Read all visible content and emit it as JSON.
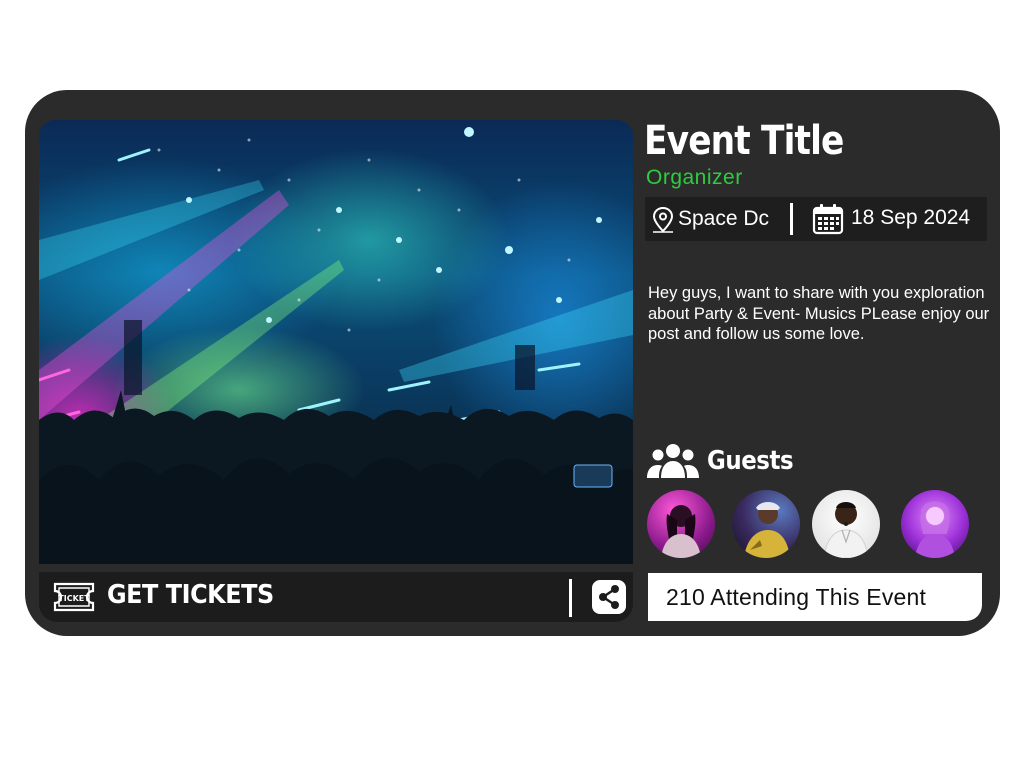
{
  "event": {
    "title": "Event Title",
    "organizer": "Organizer",
    "location": "Space Dc",
    "date": "18 Sep 2024",
    "description": "Hey guys, I want to share with you exploration about Party & Event- Musics PLease enjoy our post and follow us some love."
  },
  "tickets": {
    "badge": "TICKET",
    "label": "GET TICKETS"
  },
  "guests": {
    "heading": "Guests",
    "items": [
      "guest-1",
      "guest-2",
      "guest-3",
      "guest-4"
    ]
  },
  "attending": {
    "text": "210 Attending This Event"
  },
  "colors": {
    "card": "#2b2b2b",
    "accent": "#2ecc40",
    "bar": "#1c1c1c"
  },
  "icons": [
    "ticket-icon",
    "share-icon",
    "map-pin-icon",
    "calendar-icon",
    "users-icon"
  ]
}
